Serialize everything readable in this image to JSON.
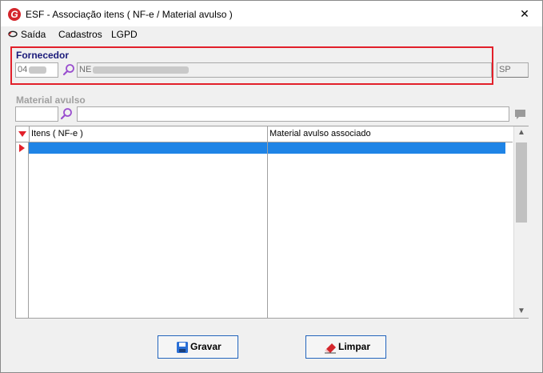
{
  "window": {
    "logo_letter": "G",
    "title": "ESF - Associação itens ( NF-e / Material avulso )",
    "close_glyph": "✕"
  },
  "menu": {
    "items": [
      {
        "label": "Saída",
        "icon": "exit-icon"
      },
      {
        "label": "Cadastros"
      },
      {
        "label": "LGPD"
      }
    ]
  },
  "fornecedor": {
    "label": "Fornecedor",
    "code_value": "04",
    "name_value": "NE",
    "uf_value": "SP"
  },
  "material_avulso": {
    "label": "Material avulso",
    "code_value": "",
    "description_value": ""
  },
  "grid": {
    "columns": [
      "Itens ( NF-e )",
      "Material avulso associado"
    ],
    "rows": [
      {
        "item": "",
        "material": ""
      }
    ]
  },
  "buttons": {
    "save_label": "Gravar",
    "clear_label": "Limpar"
  },
  "colors": {
    "highlight_frame": "#e2202a",
    "selection_row": "#1f84e6",
    "group_label": "#1a1a7a",
    "button_border": "#1c5fb8"
  }
}
